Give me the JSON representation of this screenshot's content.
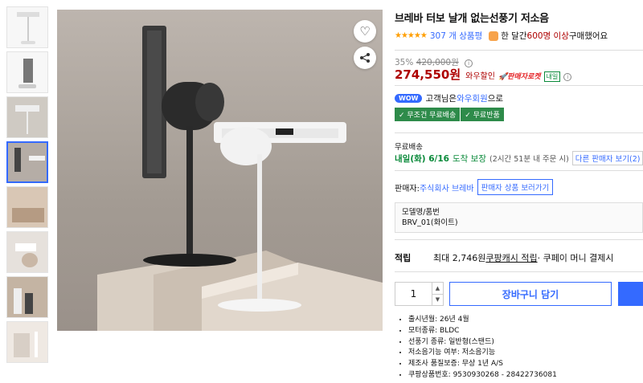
{
  "product": {
    "title": "브레바 터보 날개 없는선풍기 저소음",
    "stars": "★★★★★",
    "review_count": "307 개 상품평",
    "purchase_text_pre": "한 달간 ",
    "purchase_count": "600명 이상",
    "purchase_text_post": " 구매했어요"
  },
  "price": {
    "discount_pct": "35%",
    "original": "420,000원",
    "sale": "274,550원",
    "wow_sale": "와우할인",
    "rocket": "🚀판매자로켓",
    "tomorrow": "내일"
  },
  "wow": {
    "pill": "WOW",
    "text_pre": "고객님은 ",
    "member": "와우회원",
    "text_post": "으로"
  },
  "benefits": [
    "✓ 무조건 무료배송",
    "✓ 무료반품"
  ],
  "shipping": {
    "label": "무료배송",
    "date": "내일(화) 6/16",
    "guarantee": "도착 보장",
    "cutoff": "(2시간 51분 내 주문 시)",
    "other_seller": "다른 판매자 보기(2)"
  },
  "seller": {
    "label": "판매자: ",
    "name": "주식회사 브레바",
    "button": "판매자 상품 보러가기"
  },
  "model": {
    "label": "모델명/품번",
    "value": "BRV_01(화이트)"
  },
  "points": {
    "label": "적립",
    "text": "최대 2,746원 ",
    "cash": "쿠팡캐시 적립",
    "extra": " · 쿠페이 머니 결제시"
  },
  "cart": {
    "quantity": "1",
    "add_to_cart": "장바구니 담기"
  },
  "specs": [
    "출시년월: 26년 4월",
    "모터종류: BLDC",
    "선풍기 종류: 일반형(스탠드)",
    "저소음기능 여부: 저소음기능",
    "제조사 품질보증: 무상 1년 A/S",
    "쿠팡상품번호: 9530930268 - 28422736081"
  ],
  "icons": {
    "wishlist": "heart-icon",
    "share": "share-icon",
    "info": "info-icon"
  },
  "colors": {
    "price_red": "#ae0000",
    "accent_blue": "#346aff",
    "green": "#2e8b4a",
    "star": "#ff9f00"
  }
}
